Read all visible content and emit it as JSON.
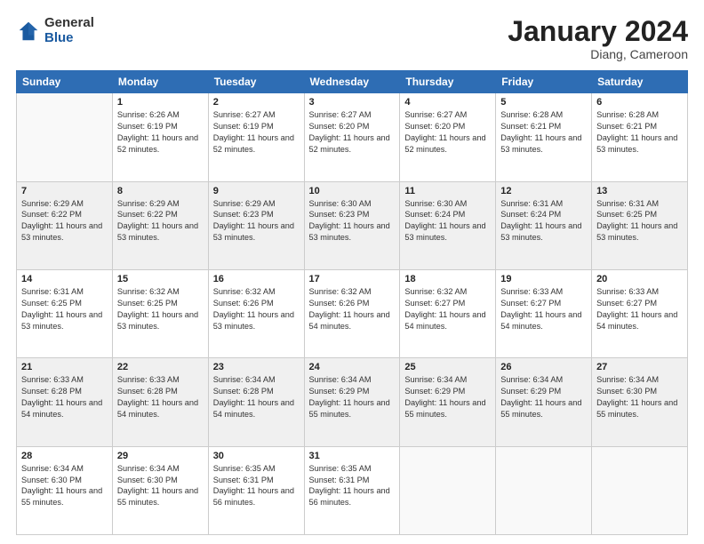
{
  "logo": {
    "general": "General",
    "blue": "Blue"
  },
  "title": "January 2024",
  "subtitle": "Diang, Cameroon",
  "days": [
    "Sunday",
    "Monday",
    "Tuesday",
    "Wednesday",
    "Thursday",
    "Friday",
    "Saturday"
  ],
  "weeks": [
    [
      {
        "date": "",
        "sunrise": "",
        "sunset": "",
        "daylight": ""
      },
      {
        "date": "1",
        "sunrise": "Sunrise: 6:26 AM",
        "sunset": "Sunset: 6:19 PM",
        "daylight": "Daylight: 11 hours and 52 minutes."
      },
      {
        "date": "2",
        "sunrise": "Sunrise: 6:27 AM",
        "sunset": "Sunset: 6:19 PM",
        "daylight": "Daylight: 11 hours and 52 minutes."
      },
      {
        "date": "3",
        "sunrise": "Sunrise: 6:27 AM",
        "sunset": "Sunset: 6:20 PM",
        "daylight": "Daylight: 11 hours and 52 minutes."
      },
      {
        "date": "4",
        "sunrise": "Sunrise: 6:27 AM",
        "sunset": "Sunset: 6:20 PM",
        "daylight": "Daylight: 11 hours and 52 minutes."
      },
      {
        "date": "5",
        "sunrise": "Sunrise: 6:28 AM",
        "sunset": "Sunset: 6:21 PM",
        "daylight": "Daylight: 11 hours and 53 minutes."
      },
      {
        "date": "6",
        "sunrise": "Sunrise: 6:28 AM",
        "sunset": "Sunset: 6:21 PM",
        "daylight": "Daylight: 11 hours and 53 minutes."
      }
    ],
    [
      {
        "date": "7",
        "sunrise": "Sunrise: 6:29 AM",
        "sunset": "Sunset: 6:22 PM",
        "daylight": "Daylight: 11 hours and 53 minutes."
      },
      {
        "date": "8",
        "sunrise": "Sunrise: 6:29 AM",
        "sunset": "Sunset: 6:22 PM",
        "daylight": "Daylight: 11 hours and 53 minutes."
      },
      {
        "date": "9",
        "sunrise": "Sunrise: 6:29 AM",
        "sunset": "Sunset: 6:23 PM",
        "daylight": "Daylight: 11 hours and 53 minutes."
      },
      {
        "date": "10",
        "sunrise": "Sunrise: 6:30 AM",
        "sunset": "Sunset: 6:23 PM",
        "daylight": "Daylight: 11 hours and 53 minutes."
      },
      {
        "date": "11",
        "sunrise": "Sunrise: 6:30 AM",
        "sunset": "Sunset: 6:24 PM",
        "daylight": "Daylight: 11 hours and 53 minutes."
      },
      {
        "date": "12",
        "sunrise": "Sunrise: 6:31 AM",
        "sunset": "Sunset: 6:24 PM",
        "daylight": "Daylight: 11 hours and 53 minutes."
      },
      {
        "date": "13",
        "sunrise": "Sunrise: 6:31 AM",
        "sunset": "Sunset: 6:25 PM",
        "daylight": "Daylight: 11 hours and 53 minutes."
      }
    ],
    [
      {
        "date": "14",
        "sunrise": "Sunrise: 6:31 AM",
        "sunset": "Sunset: 6:25 PM",
        "daylight": "Daylight: 11 hours and 53 minutes."
      },
      {
        "date": "15",
        "sunrise": "Sunrise: 6:32 AM",
        "sunset": "Sunset: 6:25 PM",
        "daylight": "Daylight: 11 hours and 53 minutes."
      },
      {
        "date": "16",
        "sunrise": "Sunrise: 6:32 AM",
        "sunset": "Sunset: 6:26 PM",
        "daylight": "Daylight: 11 hours and 53 minutes."
      },
      {
        "date": "17",
        "sunrise": "Sunrise: 6:32 AM",
        "sunset": "Sunset: 6:26 PM",
        "daylight": "Daylight: 11 hours and 54 minutes."
      },
      {
        "date": "18",
        "sunrise": "Sunrise: 6:32 AM",
        "sunset": "Sunset: 6:27 PM",
        "daylight": "Daylight: 11 hours and 54 minutes."
      },
      {
        "date": "19",
        "sunrise": "Sunrise: 6:33 AM",
        "sunset": "Sunset: 6:27 PM",
        "daylight": "Daylight: 11 hours and 54 minutes."
      },
      {
        "date": "20",
        "sunrise": "Sunrise: 6:33 AM",
        "sunset": "Sunset: 6:27 PM",
        "daylight": "Daylight: 11 hours and 54 minutes."
      }
    ],
    [
      {
        "date": "21",
        "sunrise": "Sunrise: 6:33 AM",
        "sunset": "Sunset: 6:28 PM",
        "daylight": "Daylight: 11 hours and 54 minutes."
      },
      {
        "date": "22",
        "sunrise": "Sunrise: 6:33 AM",
        "sunset": "Sunset: 6:28 PM",
        "daylight": "Daylight: 11 hours and 54 minutes."
      },
      {
        "date": "23",
        "sunrise": "Sunrise: 6:34 AM",
        "sunset": "Sunset: 6:28 PM",
        "daylight": "Daylight: 11 hours and 54 minutes."
      },
      {
        "date": "24",
        "sunrise": "Sunrise: 6:34 AM",
        "sunset": "Sunset: 6:29 PM",
        "daylight": "Daylight: 11 hours and 55 minutes."
      },
      {
        "date": "25",
        "sunrise": "Sunrise: 6:34 AM",
        "sunset": "Sunset: 6:29 PM",
        "daylight": "Daylight: 11 hours and 55 minutes."
      },
      {
        "date": "26",
        "sunrise": "Sunrise: 6:34 AM",
        "sunset": "Sunset: 6:29 PM",
        "daylight": "Daylight: 11 hours and 55 minutes."
      },
      {
        "date": "27",
        "sunrise": "Sunrise: 6:34 AM",
        "sunset": "Sunset: 6:30 PM",
        "daylight": "Daylight: 11 hours and 55 minutes."
      }
    ],
    [
      {
        "date": "28",
        "sunrise": "Sunrise: 6:34 AM",
        "sunset": "Sunset: 6:30 PM",
        "daylight": "Daylight: 11 hours and 55 minutes."
      },
      {
        "date": "29",
        "sunrise": "Sunrise: 6:34 AM",
        "sunset": "Sunset: 6:30 PM",
        "daylight": "Daylight: 11 hours and 55 minutes."
      },
      {
        "date": "30",
        "sunrise": "Sunrise: 6:35 AM",
        "sunset": "Sunset: 6:31 PM",
        "daylight": "Daylight: 11 hours and 56 minutes."
      },
      {
        "date": "31",
        "sunrise": "Sunrise: 6:35 AM",
        "sunset": "Sunset: 6:31 PM",
        "daylight": "Daylight: 11 hours and 56 minutes."
      },
      {
        "date": "",
        "sunrise": "",
        "sunset": "",
        "daylight": ""
      },
      {
        "date": "",
        "sunrise": "",
        "sunset": "",
        "daylight": ""
      },
      {
        "date": "",
        "sunrise": "",
        "sunset": "",
        "daylight": ""
      }
    ]
  ]
}
